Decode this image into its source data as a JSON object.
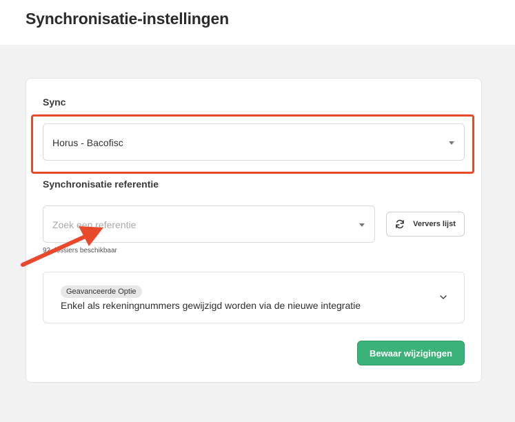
{
  "header": {
    "title": "Synchronisatie-instellingen"
  },
  "sync": {
    "label": "Sync",
    "selected": "Horus - Bacofisc"
  },
  "reference": {
    "label": "Synchronisatie referentie",
    "placeholder": "Zoek een referentie",
    "available_text": "92 dossiers beschikbaar",
    "refresh_label": "Ververs lijst"
  },
  "advanced": {
    "badge": "Geavanceerde Optie",
    "description": "Enkel als rekeningnummers gewijzigd worden via de nieuwe integratie"
  },
  "actions": {
    "save_label": "Bewaar wijzigingen"
  },
  "colors": {
    "annotation": "#e8492a",
    "save_button": "#3bb27a"
  },
  "icons": {
    "refresh": "refresh-icon",
    "chevron": "chevron-down-icon",
    "caret": "caret-down-icon"
  }
}
